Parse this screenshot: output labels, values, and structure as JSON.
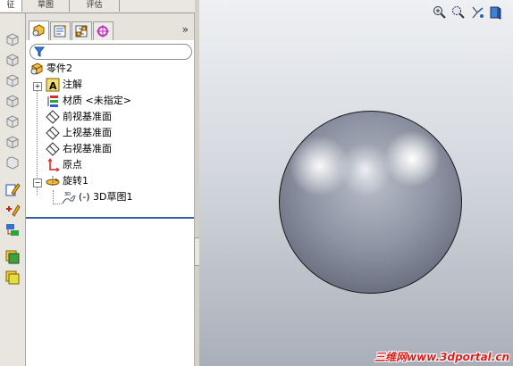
{
  "command_manager": {
    "tabs": [
      {
        "label": "征"
      },
      {
        "label": "草图"
      },
      {
        "label": "评估"
      }
    ]
  },
  "feature_manager": {
    "more_label": "»",
    "filter_icon": "filter-icon",
    "tree": [
      {
        "label": "零件2",
        "icon": "part-icon"
      },
      {
        "label": "注解",
        "icon": "annotations-icon",
        "expandable": true
      },
      {
        "label": "材质 <未指定>",
        "icon": "material-icon"
      },
      {
        "label": "前视基准面",
        "icon": "plane-icon"
      },
      {
        "label": "上视基准面",
        "icon": "plane-icon"
      },
      {
        "label": "右视基准面",
        "icon": "plane-icon"
      },
      {
        "label": "原点",
        "icon": "origin-icon"
      },
      {
        "label": "旋转1",
        "icon": "revolve-icon",
        "expanded": true
      },
      {
        "label": "(-) 3D草图1",
        "icon": "3d-sketch-icon"
      }
    ]
  },
  "viewport": {
    "watermark": "三维网www.3dportal.cn"
  },
  "colors": {
    "selection_bar": "#2f5fa8",
    "watermark": "#e21b1b"
  }
}
